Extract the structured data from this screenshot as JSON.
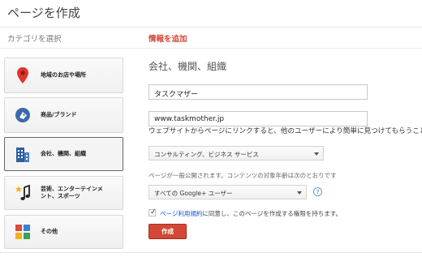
{
  "header": {
    "title": "ページを作成"
  },
  "steps": {
    "choose_category": "カテゴリを選択",
    "add_info": "情報を追加"
  },
  "categories": [
    {
      "label": "地域のお店や場所",
      "icon": "map-pin-icon"
    },
    {
      "label": "商品/ブランド",
      "icon": "tag-icon"
    },
    {
      "label": "会社、機関、組織",
      "icon": "building-icon",
      "selected": true
    },
    {
      "label": "芸術、エンターテインメント、スポーツ",
      "label_line1": "芸術、エンターテインメ",
      "label_line2": "ント、スポーツ",
      "icon": "music-note-icon"
    },
    {
      "label": "その他",
      "icon": "grid-icon"
    }
  ],
  "form": {
    "section_title": "会社、機関、組織",
    "name_value": "タスクマザー",
    "url_value": "www.taskmother.jp",
    "url_help": "ウェブサイトからページにリンクすると、他のユーザーにより簡単に見つけてもらうことができます",
    "category_select": "コンサルティング、ビジネス サービス",
    "audience_text": "ページが一般公開されます。コンテンツの対象年齢は次のとおりです",
    "audience_select": "すべての Google+ ユーザー",
    "help_glyph": "?",
    "agree_link": "ページ利用規約",
    "agree_text": "に同意し、このページを作成する権限を持ちます。",
    "create_label": "作成"
  },
  "colors": {
    "accent": "#d14836",
    "link": "#1155cc"
  }
}
